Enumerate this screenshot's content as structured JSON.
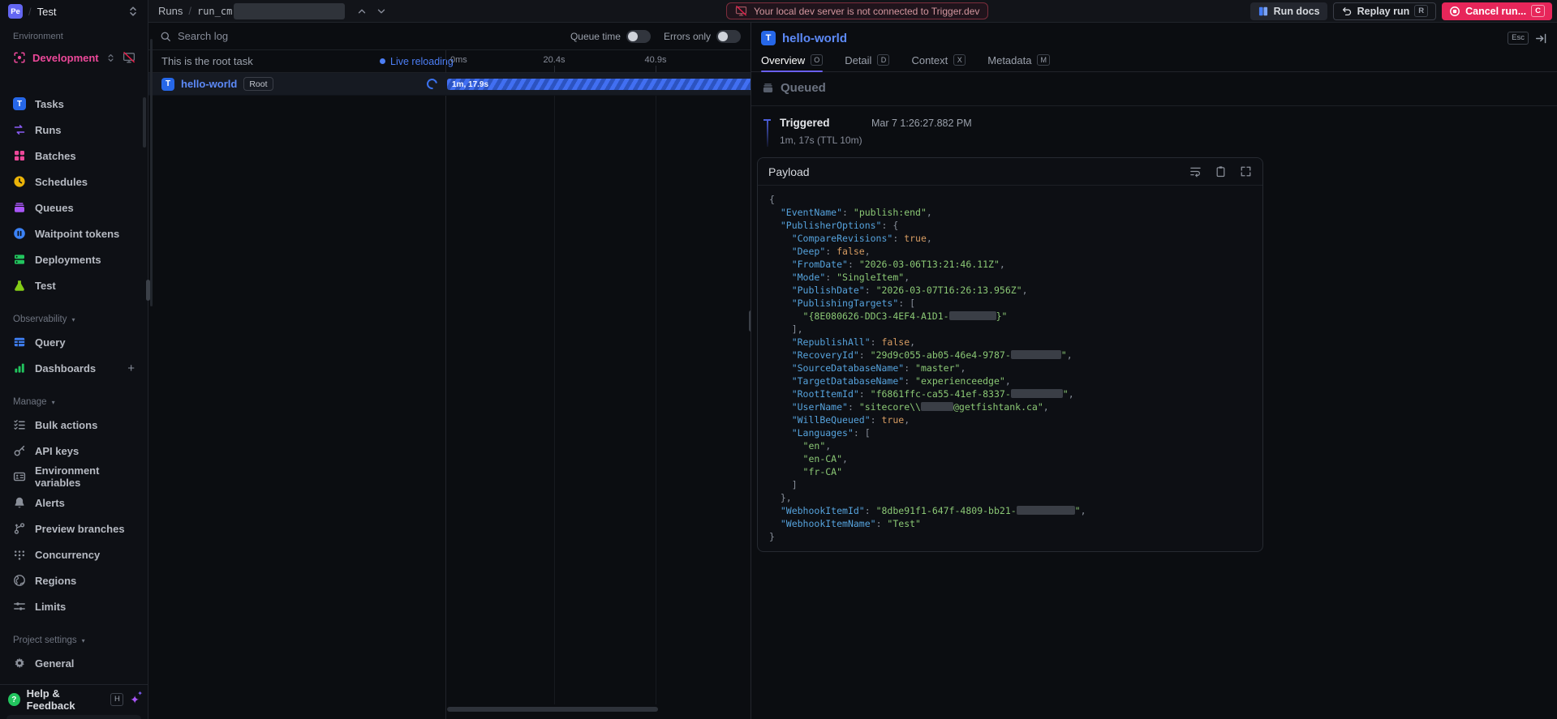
{
  "brand": {
    "logo": "Pe",
    "project": "Test"
  },
  "topbar": {
    "breadcrumb_section": "Runs",
    "run_id_prefix": "run_cm",
    "warning": "Your local dev server is not connected to Trigger.dev",
    "run_docs_label": "Run docs",
    "replay_label": "Replay run",
    "replay_shortcut": "R",
    "cancel_label": "Cancel run...",
    "cancel_shortcut": "C"
  },
  "sidebar": {
    "environment_label": "Environment",
    "environment": "Development",
    "sections": [
      {
        "header": null,
        "items": [
          {
            "label": "Tasks",
            "icon": "task",
            "color": "#2667e8"
          },
          {
            "label": "Runs",
            "icon": "runs",
            "color": "#8b5cf6"
          },
          {
            "label": "Batches",
            "icon": "batches",
            "color": "#ec4899"
          },
          {
            "label": "Schedules",
            "icon": "schedules",
            "color": "#eab308"
          },
          {
            "label": "Queues",
            "icon": "queues",
            "color": "#a855f7"
          },
          {
            "label": "Waitpoint tokens",
            "icon": "waitpoint",
            "color": "#3b82f6"
          },
          {
            "label": "Deployments",
            "icon": "deployments",
            "color": "#22c55e"
          },
          {
            "label": "Test",
            "icon": "flask",
            "color": "#84cc16"
          }
        ]
      },
      {
        "header": "Observability",
        "items": [
          {
            "label": "Query",
            "icon": "query",
            "color": "#3f7ff2"
          },
          {
            "label": "Dashboards",
            "icon": "dashboards",
            "color": "#22c55e",
            "trailing": "+"
          }
        ]
      },
      {
        "header": "Manage",
        "items": [
          {
            "label": "Bulk actions",
            "icon": "bulk",
            "color": "#8a8f99"
          },
          {
            "label": "API keys",
            "icon": "key",
            "color": "#8a8f99"
          },
          {
            "label": "Environment variables",
            "icon": "envvars",
            "color": "#8a8f99"
          },
          {
            "label": "Alerts",
            "icon": "bell",
            "color": "#8a8f99"
          },
          {
            "label": "Preview branches",
            "icon": "branch",
            "color": "#8a8f99"
          },
          {
            "label": "Concurrency",
            "icon": "concurrency",
            "color": "#8a8f99"
          },
          {
            "label": "Regions",
            "icon": "globe",
            "color": "#8a8f99"
          },
          {
            "label": "Limits",
            "icon": "limits",
            "color": "#8a8f99"
          }
        ]
      },
      {
        "header": "Project settings",
        "items": [
          {
            "label": "General",
            "icon": "gear",
            "color": "#8a8f99"
          }
        ]
      }
    ],
    "help_label": "Help & Feedback",
    "help_shortcut": "H"
  },
  "log_panel": {
    "search_placeholder": "Search log",
    "toggles": [
      {
        "label": "Queue time",
        "on": false
      },
      {
        "label": "Errors only",
        "on": false
      }
    ],
    "root_note": "This is the root task",
    "live_label": "Live reloading",
    "timeline_ticks": [
      "0ms",
      "20.4s",
      "40.9s"
    ],
    "task_name": "hello-world",
    "task_badge": "Root",
    "bar_label": "1m, 17.9s"
  },
  "run_panel": {
    "title": "hello-world",
    "esc_label": "Esc",
    "tabs": [
      {
        "label": "Overview",
        "shortcut": "O",
        "active": true
      },
      {
        "label": "Detail",
        "shortcut": "D",
        "active": false
      },
      {
        "label": "Context",
        "shortcut": "X",
        "active": false
      },
      {
        "label": "Metadata",
        "shortcut": "M",
        "active": false
      }
    ],
    "status": "Queued",
    "triggered_label": "Triggered",
    "triggered_time": "Mar 7 1:26:27.882 PM",
    "triggered_duration": "1m, 17s (TTL 10m)",
    "payload_title": "Payload",
    "payload_lines": [
      [
        {
          "t": "{",
          "c": "p"
        }
      ],
      [
        {
          "t": "  ",
          "c": "p"
        },
        {
          "t": "\"EventName\"",
          "c": "k"
        },
        {
          "t": ": ",
          "c": "p"
        },
        {
          "t": "\"publish:end\"",
          "c": "s"
        },
        {
          "t": ",",
          "c": "p"
        }
      ],
      [
        {
          "t": "  ",
          "c": "p"
        },
        {
          "t": "\"PublisherOptions\"",
          "c": "k"
        },
        {
          "t": ": {",
          "c": "p"
        }
      ],
      [
        {
          "t": "    ",
          "c": "p"
        },
        {
          "t": "\"CompareRevisions\"",
          "c": "k"
        },
        {
          "t": ": ",
          "c": "p"
        },
        {
          "t": "true",
          "c": "b"
        },
        {
          "t": ",",
          "c": "p"
        }
      ],
      [
        {
          "t": "    ",
          "c": "p"
        },
        {
          "t": "\"Deep\"",
          "c": "k"
        },
        {
          "t": ": ",
          "c": "p"
        },
        {
          "t": "false",
          "c": "b"
        },
        {
          "t": ",",
          "c": "p"
        }
      ],
      [
        {
          "t": "    ",
          "c": "p"
        },
        {
          "t": "\"FromDate\"",
          "c": "k"
        },
        {
          "t": ": ",
          "c": "p"
        },
        {
          "t": "\"2026-03-06T13:21:46.11Z\"",
          "c": "s"
        },
        {
          "t": ",",
          "c": "p"
        }
      ],
      [
        {
          "t": "    ",
          "c": "p"
        },
        {
          "t": "\"Mode\"",
          "c": "k"
        },
        {
          "t": ": ",
          "c": "p"
        },
        {
          "t": "\"SingleItem\"",
          "c": "s"
        },
        {
          "t": ",",
          "c": "p"
        }
      ],
      [
        {
          "t": "    ",
          "c": "p"
        },
        {
          "t": "\"PublishDate\"",
          "c": "k"
        },
        {
          "t": ": ",
          "c": "p"
        },
        {
          "t": "\"2026-03-07T16:26:13.956Z\"",
          "c": "s"
        },
        {
          "t": ",",
          "c": "p"
        }
      ],
      [
        {
          "t": "    ",
          "c": "p"
        },
        {
          "t": "\"PublishingTargets\"",
          "c": "k"
        },
        {
          "t": ": [",
          "c": "p"
        }
      ],
      [
        {
          "t": "      ",
          "c": "p"
        },
        {
          "t": "\"{8E080626-DDC3-4EF4-A1D1-",
          "c": "s"
        },
        {
          "r": 58
        },
        {
          "t": "}\"",
          "c": "s"
        }
      ],
      [
        {
          "t": "    ],",
          "c": "p"
        }
      ],
      [
        {
          "t": "    ",
          "c": "p"
        },
        {
          "t": "\"RepublishAll\"",
          "c": "k"
        },
        {
          "t": ": ",
          "c": "p"
        },
        {
          "t": "false",
          "c": "b"
        },
        {
          "t": ",",
          "c": "p"
        }
      ],
      [
        {
          "t": "    ",
          "c": "p"
        },
        {
          "t": "\"RecoveryId\"",
          "c": "k"
        },
        {
          "t": ": ",
          "c": "p"
        },
        {
          "t": "\"29d9c055-ab05-46e4-9787-",
          "c": "s"
        },
        {
          "r": 62
        },
        {
          "t": "\"",
          "c": "s"
        },
        {
          "t": ",",
          "c": "p"
        }
      ],
      [
        {
          "t": "    ",
          "c": "p"
        },
        {
          "t": "\"SourceDatabaseName\"",
          "c": "k"
        },
        {
          "t": ": ",
          "c": "p"
        },
        {
          "t": "\"master\"",
          "c": "s"
        },
        {
          "t": ",",
          "c": "p"
        }
      ],
      [
        {
          "t": "    ",
          "c": "p"
        },
        {
          "t": "\"TargetDatabaseName\"",
          "c": "k"
        },
        {
          "t": ": ",
          "c": "p"
        },
        {
          "t": "\"experienceedge\"",
          "c": "s"
        },
        {
          "t": ",",
          "c": "p"
        }
      ],
      [
        {
          "t": "    ",
          "c": "p"
        },
        {
          "t": "\"RootItemId\"",
          "c": "k"
        },
        {
          "t": ": ",
          "c": "p"
        },
        {
          "t": "\"f6861ffc-ca55-41ef-8337-",
          "c": "s"
        },
        {
          "r": 64
        },
        {
          "t": "\"",
          "c": "s"
        },
        {
          "t": ",",
          "c": "p"
        }
      ],
      [
        {
          "t": "    ",
          "c": "p"
        },
        {
          "t": "\"UserName\"",
          "c": "k"
        },
        {
          "t": ": ",
          "c": "p"
        },
        {
          "t": "\"sitecore\\\\",
          "c": "s"
        },
        {
          "r": 40
        },
        {
          "t": "@getfishtank.ca\"",
          "c": "s"
        },
        {
          "t": ",",
          "c": "p"
        }
      ],
      [
        {
          "t": "    ",
          "c": "p"
        },
        {
          "t": "\"WillBeQueued\"",
          "c": "k"
        },
        {
          "t": ": ",
          "c": "p"
        },
        {
          "t": "true",
          "c": "b"
        },
        {
          "t": ",",
          "c": "p"
        }
      ],
      [
        {
          "t": "    ",
          "c": "p"
        },
        {
          "t": "\"Languages\"",
          "c": "k"
        },
        {
          "t": ": [",
          "c": "p"
        }
      ],
      [
        {
          "t": "      ",
          "c": "p"
        },
        {
          "t": "\"en\"",
          "c": "s"
        },
        {
          "t": ",",
          "c": "p"
        }
      ],
      [
        {
          "t": "      ",
          "c": "p"
        },
        {
          "t": "\"en-CA\"",
          "c": "s"
        },
        {
          "t": ",",
          "c": "p"
        }
      ],
      [
        {
          "t": "      ",
          "c": "p"
        },
        {
          "t": "\"fr-CA\"",
          "c": "s"
        }
      ],
      [
        {
          "t": "    ]",
          "c": "p"
        }
      ],
      [
        {
          "t": "  },",
          "c": "p"
        }
      ],
      [
        {
          "t": "  ",
          "c": "p"
        },
        {
          "t": "\"WebhookItemId\"",
          "c": "k"
        },
        {
          "t": ": ",
          "c": "p"
        },
        {
          "t": "\"8dbe91f1-647f-4809-bb21-",
          "c": "s"
        },
        {
          "r": 72
        },
        {
          "t": "\"",
          "c": "s"
        },
        {
          "t": ",",
          "c": "p"
        }
      ],
      [
        {
          "t": "  ",
          "c": "p"
        },
        {
          "t": "\"WebhookItemName\"",
          "c": "k"
        },
        {
          "t": ": ",
          "c": "p"
        },
        {
          "t": "\"Test\"",
          "c": "s"
        }
      ],
      [
        {
          "t": "}",
          "c": "p"
        }
      ]
    ]
  },
  "colors": {
    "accent_blue": "#5d8af8",
    "env_pink": "#ec4899",
    "cancel_red": "#e7265a",
    "active_tab_indigo": "#6a5ff2",
    "warning_red": "#e11d48",
    "json_key": "#56a3dd",
    "json_string": "#8bc875",
    "json_bool": "#d79c62"
  }
}
